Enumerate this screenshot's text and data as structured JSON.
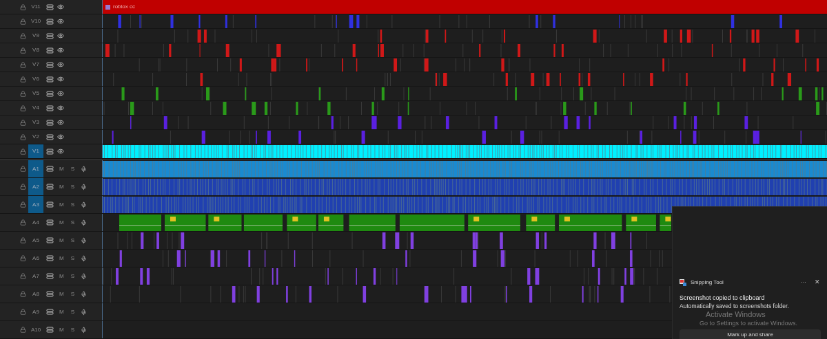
{
  "video_tracks": [
    {
      "name": "V11",
      "targeted": false,
      "kind": "title",
      "color": "#c00000",
      "clip_label": "roblox cc"
    },
    {
      "name": "V10",
      "targeted": false,
      "kind": "sparse",
      "color": "#3030e0"
    },
    {
      "name": "V9",
      "targeted": false,
      "kind": "sparse",
      "color": "#d01818"
    },
    {
      "name": "V8",
      "targeted": false,
      "kind": "sparse",
      "color": "#d01818"
    },
    {
      "name": "V7",
      "targeted": false,
      "kind": "sparse",
      "color": "#d01818"
    },
    {
      "name": "V6",
      "targeted": false,
      "kind": "sparse",
      "color": "#d01818"
    },
    {
      "name": "V5",
      "targeted": false,
      "kind": "sparse",
      "color": "#2a9a1a"
    },
    {
      "name": "V4",
      "targeted": false,
      "kind": "sparse",
      "color": "#2a9a1a"
    },
    {
      "name": "V3",
      "targeted": false,
      "kind": "sparse",
      "color": "#5a20e0"
    },
    {
      "name": "V2",
      "targeted": false,
      "kind": "sparse",
      "color": "#5a20e0"
    },
    {
      "name": "V1",
      "targeted": true,
      "kind": "dense",
      "color": "#00f0ff"
    }
  ],
  "audio_tracks": [
    {
      "name": "A1",
      "targeted": true,
      "kind": "dense",
      "color": "#1a8ad0",
      "mute_label": "M",
      "solo_label": "S"
    },
    {
      "name": "A2",
      "targeted": true,
      "kind": "dense",
      "color": "#2040b0",
      "mute_label": "M",
      "solo_label": "S"
    },
    {
      "name": "A3",
      "targeted": true,
      "kind": "dense",
      "color": "#2040b0",
      "mute_label": "M",
      "solo_label": "S"
    },
    {
      "name": "A4",
      "targeted": false,
      "kind": "blocks",
      "color": "#1f8a10",
      "mute_label": "M",
      "solo_label": "S"
    },
    {
      "name": "A5",
      "targeted": false,
      "kind": "sparse",
      "color": "#8040e0",
      "mute_label": "M",
      "solo_label": "S"
    },
    {
      "name": "A6",
      "targeted": false,
      "kind": "sparse",
      "color": "#8040e0",
      "mute_label": "M",
      "solo_label": "S"
    },
    {
      "name": "A7",
      "targeted": false,
      "kind": "sparse",
      "color": "#8040e0",
      "mute_label": "M",
      "solo_label": "S"
    },
    {
      "name": "A8",
      "targeted": false,
      "kind": "sparse",
      "color": "#8040e0",
      "mute_label": "M",
      "solo_label": "S"
    },
    {
      "name": "A9",
      "targeted": false,
      "kind": "empty",
      "mute_label": "M",
      "solo_label": "S"
    },
    {
      "name": "A10",
      "targeted": false,
      "kind": "empty",
      "mute_label": "M",
      "solo_label": "S"
    }
  ],
  "notification": {
    "app": "Snipping Tool",
    "more": "···",
    "close": "✕",
    "title": "Screenshot copied to clipboard",
    "body": "Automatically saved to screenshots folder.",
    "button": "Mark up and share"
  },
  "activation": {
    "title": "Activate Windows",
    "body": "Go to Settings to activate Windows."
  }
}
